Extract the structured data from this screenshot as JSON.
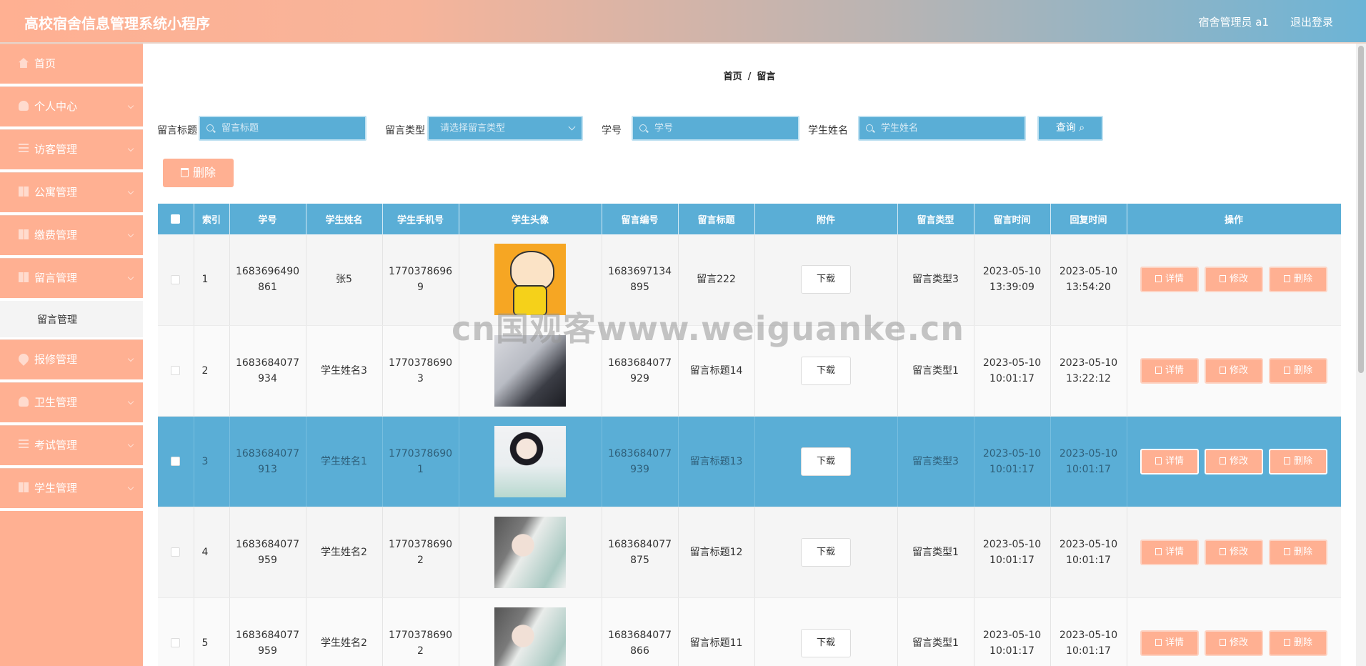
{
  "header": {
    "title": "高校宿舍信息管理系统小程序",
    "user": "宿舍管理员 a1",
    "logout": "退出登录"
  },
  "sidebar": {
    "items": [
      {
        "label": "首页",
        "icon": "home-icon"
      },
      {
        "label": "个人中心",
        "icon": "user-icon"
      },
      {
        "label": "访客管理",
        "icon": "list-icon"
      },
      {
        "label": "公寓管理",
        "icon": "building-icon"
      },
      {
        "label": "缴费管理",
        "icon": "grid-icon"
      },
      {
        "label": "留言管理",
        "icon": "grid-icon"
      }
    ],
    "sub_active": "留言管理",
    "items2": [
      {
        "label": "报修管理",
        "icon": "pin-icon"
      },
      {
        "label": "卫生管理",
        "icon": "user-icon"
      },
      {
        "label": "考试管理",
        "icon": "list-icon"
      },
      {
        "label": "学生管理",
        "icon": "grid-icon"
      }
    ]
  },
  "breadcrumb": {
    "home": "首页",
    "sep": "/",
    "current": "留言"
  },
  "search": {
    "title_label": "留言标题",
    "title_placeholder": "留言标题",
    "type_label": "留言类型",
    "type_placeholder": "请选择留言类型",
    "xuehao_label": "学号",
    "xuehao_placeholder": "学号",
    "name_label": "学生姓名",
    "name_placeholder": "学生姓名",
    "query": "查询"
  },
  "toolbar": {
    "delete": "删除"
  },
  "table": {
    "headers": [
      "索引",
      "学号",
      "学生姓名",
      "学生手机号",
      "学生头像",
      "留言编号",
      "留言标题",
      "附件",
      "留言类型",
      "留言时间",
      "回复时间",
      "操作"
    ],
    "download": "下载",
    "ops": {
      "detail": "详情",
      "edit": "修改",
      "delete": "删除"
    },
    "rows": [
      {
        "idx": "1",
        "xh1": "1683696490",
        "xh2": "861",
        "name": "张5",
        "ph1": "1770378696",
        "ph2": "9",
        "no1": "1683697134",
        "no2": "895",
        "title": "留言222",
        "type": "留言类型3",
        "t1d": "2023-05-10",
        "t1t": "13:39:09",
        "t2d": "2023-05-10",
        "t2t": "13:54:20"
      },
      {
        "idx": "2",
        "xh1": "1683684077",
        "xh2": "934",
        "name": "学生姓名3",
        "ph1": "1770378690",
        "ph2": "3",
        "no1": "1683684077",
        "no2": "929",
        "title": "留言标题14",
        "type": "留言类型1",
        "t1d": "2023-05-10",
        "t1t": "10:01:17",
        "t2d": "2023-05-10",
        "t2t": "13:22:12"
      },
      {
        "idx": "3",
        "xh1": "1683684077",
        "xh2": "913",
        "name": "学生姓名1",
        "ph1": "1770378690",
        "ph2": "1",
        "no1": "1683684077",
        "no2": "939",
        "title": "留言标题13",
        "type": "留言类型3",
        "t1d": "2023-05-10",
        "t1t": "10:01:17",
        "t2d": "2023-05-10",
        "t2t": "10:01:17"
      },
      {
        "idx": "4",
        "xh1": "1683684077",
        "xh2": "959",
        "name": "学生姓名2",
        "ph1": "1770378690",
        "ph2": "2",
        "no1": "1683684077",
        "no2": "875",
        "title": "留言标题12",
        "type": "留言类型1",
        "t1d": "2023-05-10",
        "t1t": "10:01:17",
        "t2d": "2023-05-10",
        "t2t": "10:01:17"
      },
      {
        "idx": "5",
        "xh1": "1683684077",
        "xh2": "959",
        "name": "学生姓名2",
        "ph1": "1770378690",
        "ph2": "2",
        "no1": "1683684077",
        "no2": "866",
        "title": "留言标题11",
        "type": "留言类型1",
        "t1d": "2023-05-10",
        "t1t": "10:01:17",
        "t2d": "2023-05-10",
        "t2t": "10:01:17"
      }
    ]
  },
  "watermark": "cn国观客www.weiguanke.cn"
}
